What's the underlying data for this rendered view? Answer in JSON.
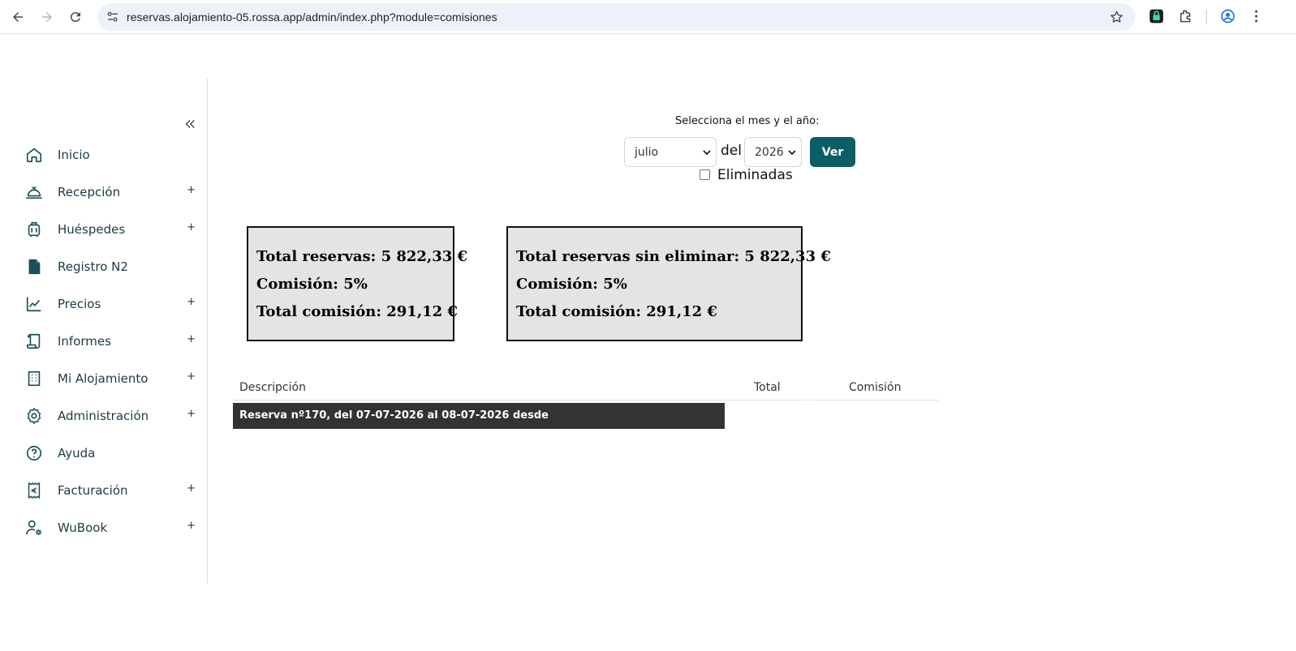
{
  "browser": {
    "url": "reservas.alojamiento-05.rossa.app/admin/index.php?module=comisiones"
  },
  "sidebar": {
    "items": [
      {
        "label": "Inicio",
        "icon": "home-icon",
        "expandable": false
      },
      {
        "label": "Recepción",
        "icon": "reception-bell-icon",
        "expandable": true
      },
      {
        "label": "Huéspedes",
        "icon": "luggage-icon",
        "expandable": true
      },
      {
        "label": "Registro N2",
        "icon": "csv-file-icon",
        "expandable": false
      },
      {
        "label": "Precios",
        "icon": "line-chart-icon",
        "expandable": true
      },
      {
        "label": "Informes",
        "icon": "scroll-icon",
        "expandable": true
      },
      {
        "label": "Mi Alojamiento",
        "icon": "building-icon",
        "expandable": true
      },
      {
        "label": "Administración",
        "icon": "gear-icon",
        "expandable": true
      },
      {
        "label": "Ayuda",
        "icon": "help-circle-icon",
        "expandable": false
      },
      {
        "label": "Facturación",
        "icon": "euro-receipt-icon",
        "expandable": true
      },
      {
        "label": "WuBook",
        "icon": "user-gear-icon",
        "expandable": true
      }
    ],
    "plus": "+"
  },
  "filter": {
    "label": "Selecciona el mes y el año:",
    "month": "julio",
    "connector": "del",
    "year": "2026",
    "button": "Ver",
    "checkbox_label": "Eliminadas",
    "checkbox_checked": false
  },
  "summary_left": {
    "total": "Total reservas: 5 822,33 €",
    "commission": "Comisión: 5%",
    "total_commission": "Total comisión: 291,12 €"
  },
  "summary_right": {
    "total": "Total reservas sin eliminar: 5 822,33 €",
    "commission": "Comisión: 5%",
    "total_commission": "Total comisión: 291,12 €"
  },
  "table": {
    "headers": {
      "description": "Descripción",
      "total": "Total",
      "commission": "Comisión"
    },
    "rows": [
      {
        "description": "Reserva nº170, del 07-07-2026 al 08-07-2026 desde"
      }
    ]
  },
  "colors": {
    "accent": "#0b5e64",
    "sidebar_icon": "#1c4f57",
    "row_bar": "#333333",
    "summary_box": "#e4e4e4"
  }
}
